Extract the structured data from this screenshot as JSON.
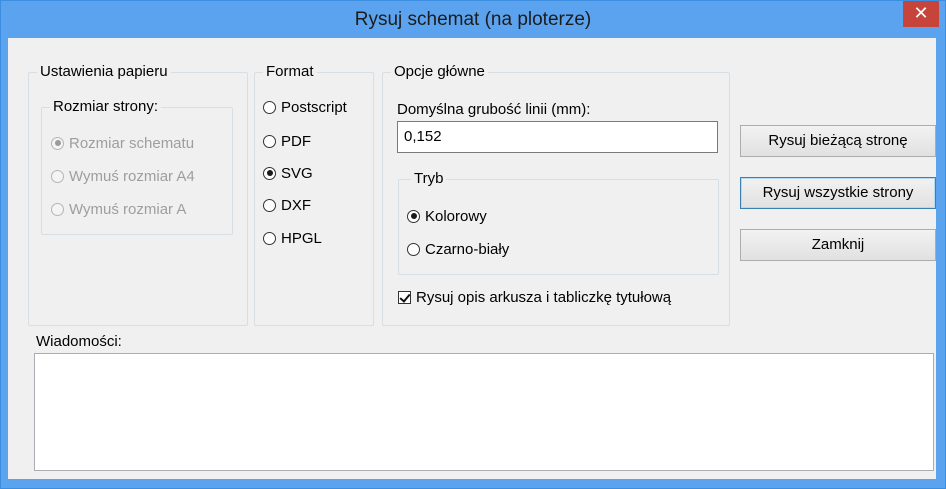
{
  "window": {
    "title": "Rysuj schemat (na ploterze)",
    "close_glyph": "✕"
  },
  "paper": {
    "legend": "Ustawienia papieru",
    "size_legend": "Rozmiar strony:",
    "options": [
      "Rozmiar schematu",
      "Wymuś rozmiar A4",
      "Wymuś rozmiar A"
    ],
    "selected_index": 0
  },
  "format": {
    "legend": "Format",
    "options": [
      "Postscript",
      "PDF",
      "SVG",
      "DXF",
      "HPGL"
    ],
    "selected_index": 2
  },
  "main_options": {
    "legend": "Opcje główne",
    "line_width_label": "Domyślna grubość linii (mm):",
    "line_width_value": "0,152",
    "mode_legend": "Tryb",
    "mode_options": [
      "Kolorowy",
      "Czarno-biały"
    ],
    "mode_selected_index": 0,
    "plot_frame_label": "Rysuj opis arkusza i tabliczkę tytułową",
    "plot_frame_checked": true
  },
  "buttons": {
    "plot_current": "Rysuj bieżącą stronę",
    "plot_all": "Rysuj wszystkie strony",
    "close": "Zamknij"
  },
  "messages": {
    "label": "Wiadomości:",
    "value": ""
  },
  "colors": {
    "titlebar": "#5ba3ee",
    "close_button": "#c7443a",
    "client_bg": "#f0f0f0"
  }
}
